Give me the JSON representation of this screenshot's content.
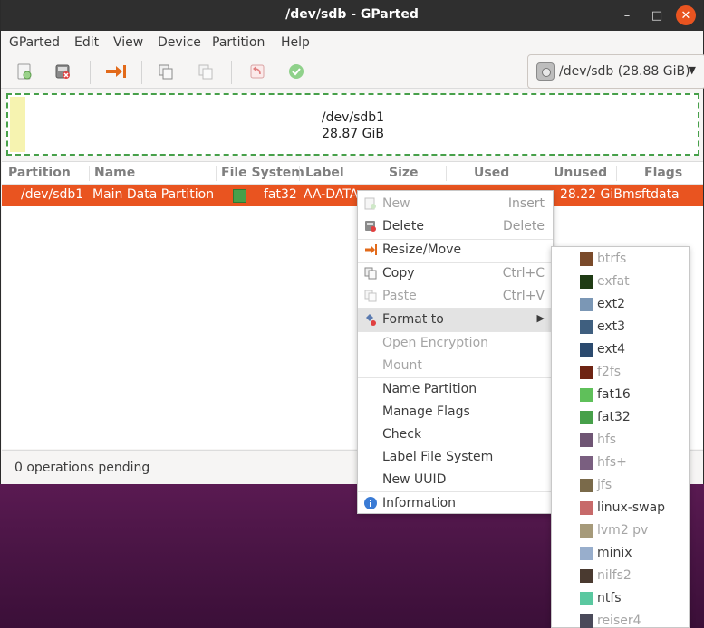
{
  "window": {
    "title": "/dev/sdb - GParted",
    "minimize_glyph": "–",
    "maximize_glyph": "□",
    "close_glyph": "✕"
  },
  "menubar": [
    "GParted",
    "Edit",
    "View",
    "Device",
    "Partition",
    "Help"
  ],
  "toolbar": {
    "icons": [
      "new-partition-icon",
      "delete-partition-icon",
      "resize-move-icon",
      "copy-icon",
      "paste-icon",
      "undo-icon",
      "apply-icon"
    ],
    "device_selector": "/dev/sdb (28.88 GiB)"
  },
  "disk_map": {
    "partition": "/dev/sdb1",
    "size": "28.87 GiB"
  },
  "columns": [
    "Partition",
    "Name",
    "File System",
    "Label",
    "Size",
    "Used",
    "Unused",
    "Flags"
  ],
  "rows": [
    {
      "partition": "/dev/sdb1",
      "name": "Main Data Partition",
      "filesystem": "fat32",
      "label": "AA-DATA",
      "unused": "28.22 GiB",
      "flags": "msftdata",
      "fs_color": "#47a04a"
    }
  ],
  "status": "0 operations pending",
  "context_menu": [
    {
      "label": "New",
      "accel": "Insert",
      "disabled": true
    },
    {
      "label": "Delete",
      "accel": "Delete",
      "disabled": false
    },
    {
      "label": "Resize/Move",
      "accel": "",
      "disabled": false
    },
    {
      "label": "Copy",
      "accel": "Ctrl+C",
      "disabled": false
    },
    {
      "label": "Paste",
      "accel": "Ctrl+V",
      "disabled": true
    },
    {
      "label": "Format to",
      "accel": "",
      "disabled": false
    },
    {
      "label": "Open Encryption",
      "accel": "",
      "disabled": true
    },
    {
      "label": "Mount",
      "accel": "",
      "disabled": true
    },
    {
      "label": "Name Partition",
      "accel": "",
      "disabled": false
    },
    {
      "label": "Manage Flags",
      "accel": "",
      "disabled": false
    },
    {
      "label": "Check",
      "accel": "",
      "disabled": false
    },
    {
      "label": "Label File System",
      "accel": "",
      "disabled": false
    },
    {
      "label": "New UUID",
      "accel": "",
      "disabled": false
    },
    {
      "label": "Information",
      "accel": "",
      "disabled": false
    }
  ],
  "format_submenu": [
    {
      "label": "btrfs",
      "color": "#7a4a2a",
      "disabled": true
    },
    {
      "label": "exfat",
      "color": "#1f3b14",
      "disabled": true
    },
    {
      "label": "ext2",
      "color": "#7b97b5",
      "disabled": false
    },
    {
      "label": "ext3",
      "color": "#3f5f7f",
      "disabled": false
    },
    {
      "label": "ext4",
      "color": "#2b4a6e",
      "disabled": false
    },
    {
      "label": "f2fs",
      "color": "#6e2413",
      "disabled": true
    },
    {
      "label": "fat16",
      "color": "#5fc05a",
      "disabled": false
    },
    {
      "label": "fat32",
      "color": "#47a04a",
      "disabled": false
    },
    {
      "label": "hfs",
      "color": "#6f5574",
      "disabled": true
    },
    {
      "label": "hfs+",
      "color": "#7a5f80",
      "disabled": true
    },
    {
      "label": "jfs",
      "color": "#7a6a4a",
      "disabled": true
    },
    {
      "label": "linux-swap",
      "color": "#c76a6a",
      "disabled": false
    },
    {
      "label": "lvm2 pv",
      "color": "#a69a7a",
      "disabled": true
    },
    {
      "label": "minix",
      "color": "#98aecc",
      "disabled": false
    },
    {
      "label": "nilfs2",
      "color": "#4a3a30",
      "disabled": true
    },
    {
      "label": "ntfs",
      "color": "#5ac8a0",
      "disabled": false
    },
    {
      "label": "reiser4",
      "color": "#4a4a5a",
      "disabled": true
    }
  ]
}
